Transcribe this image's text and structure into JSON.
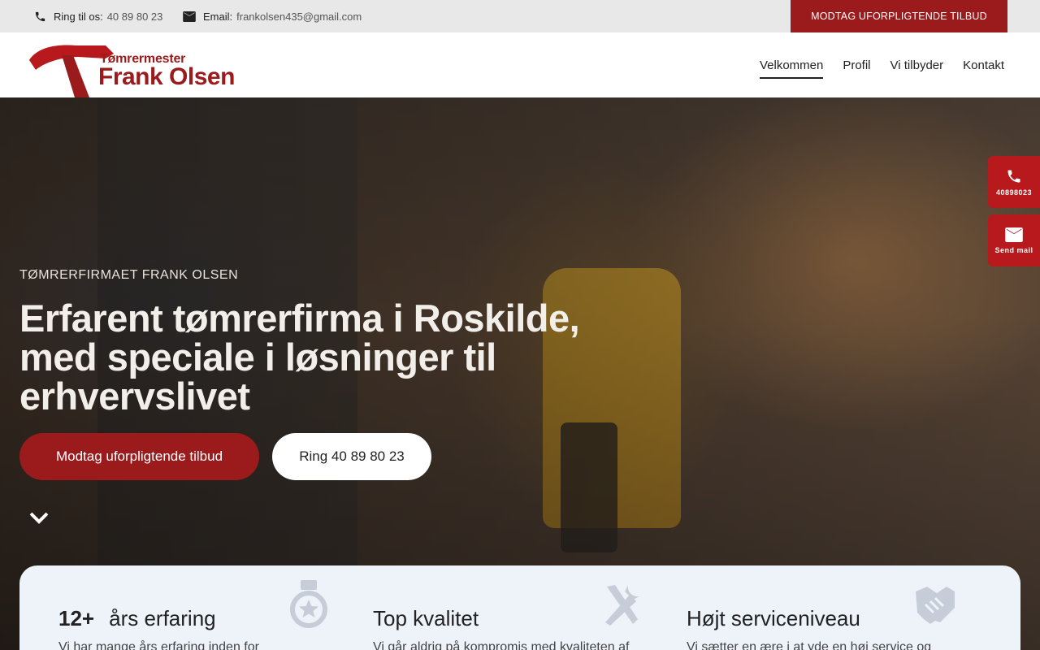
{
  "topbar": {
    "phone_label": "Ring til os:",
    "phone_value": "40 89 80 23",
    "email_label": "Email:",
    "email_value": "frankolsen435@gmail.com",
    "cta": "MODTAG UFORPLIGTENDE TILBUD"
  },
  "logo": {
    "small": "Tømrermester",
    "big": "Frank Olsen"
  },
  "nav": {
    "items": [
      {
        "label": "Velkommen",
        "active": true
      },
      {
        "label": "Profil"
      },
      {
        "label": "Vi tilbyder"
      },
      {
        "label": "Kontakt"
      }
    ]
  },
  "hero": {
    "eyebrow": "TØMRERFIRMAET FRANK OLSEN",
    "headline": "Erfarent tømrerfirma i Roskilde, med speciale i løsninger til erhvervslivet",
    "primary_button": "Modtag uforpligtende tilbud",
    "secondary_button": "Ring 40 89 80 23"
  },
  "side": {
    "phone": "40898023",
    "mail": "Send mail"
  },
  "features": [
    {
      "num": "12+",
      "title": "års erfaring",
      "desc": "Vi har mange års erfaring inden for",
      "icon": "medal-icon"
    },
    {
      "num": "",
      "title": "Top kvalitet",
      "desc": "Vi går aldrig på kompromis med kvaliteten af",
      "icon": "tools-icon"
    },
    {
      "num": "",
      "title": "Højt serviceniveau",
      "desc": "Vi sætter en ære i at yde en høj service og",
      "icon": "handshake-icon"
    }
  ],
  "colors": {
    "brand_red": "#9b1b1d",
    "side_red": "#b7191c",
    "panel_bg": "#eef2f9"
  }
}
